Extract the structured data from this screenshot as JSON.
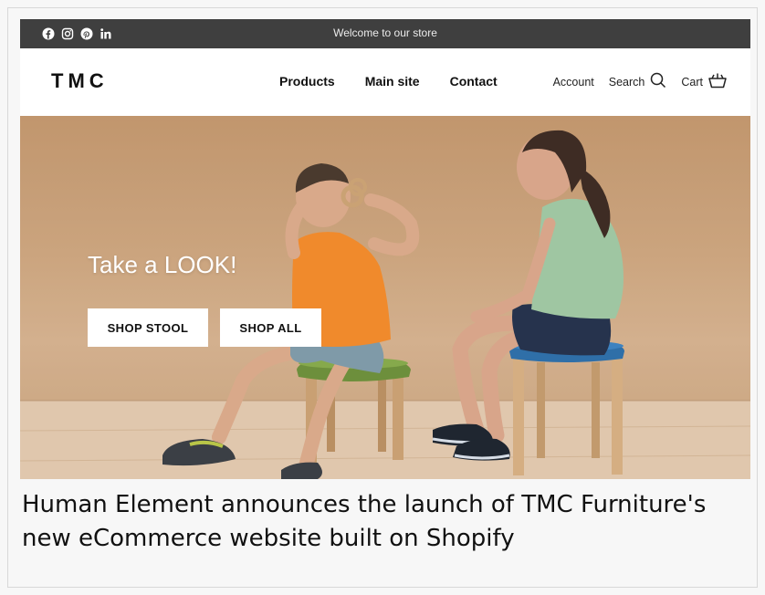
{
  "topbar": {
    "welcome": "Welcome to our store",
    "social": [
      "facebook-icon",
      "instagram-icon",
      "pinterest-icon",
      "linkedin-icon"
    ]
  },
  "header": {
    "logo": "TMC",
    "nav": [
      "Products",
      "Main site",
      "Contact"
    ],
    "account": "Account",
    "search": "Search",
    "cart": "Cart"
  },
  "hero": {
    "title": "Take a LOOK!",
    "buttons": [
      "SHOP STOOL",
      "SHOP ALL"
    ]
  },
  "caption": "Human Element announces the launch of TMC Furniture's new eCommerce website built on Shopify",
  "colors": {
    "topbar": "#3f3f3f",
    "wall": "#d4ab84",
    "stool_green_seat": "#6d8f3c",
    "stool_blue_seat": "#2f6fa8",
    "shirt_orange": "#f08a2c",
    "shirt_mint": "#9fc6a2"
  }
}
